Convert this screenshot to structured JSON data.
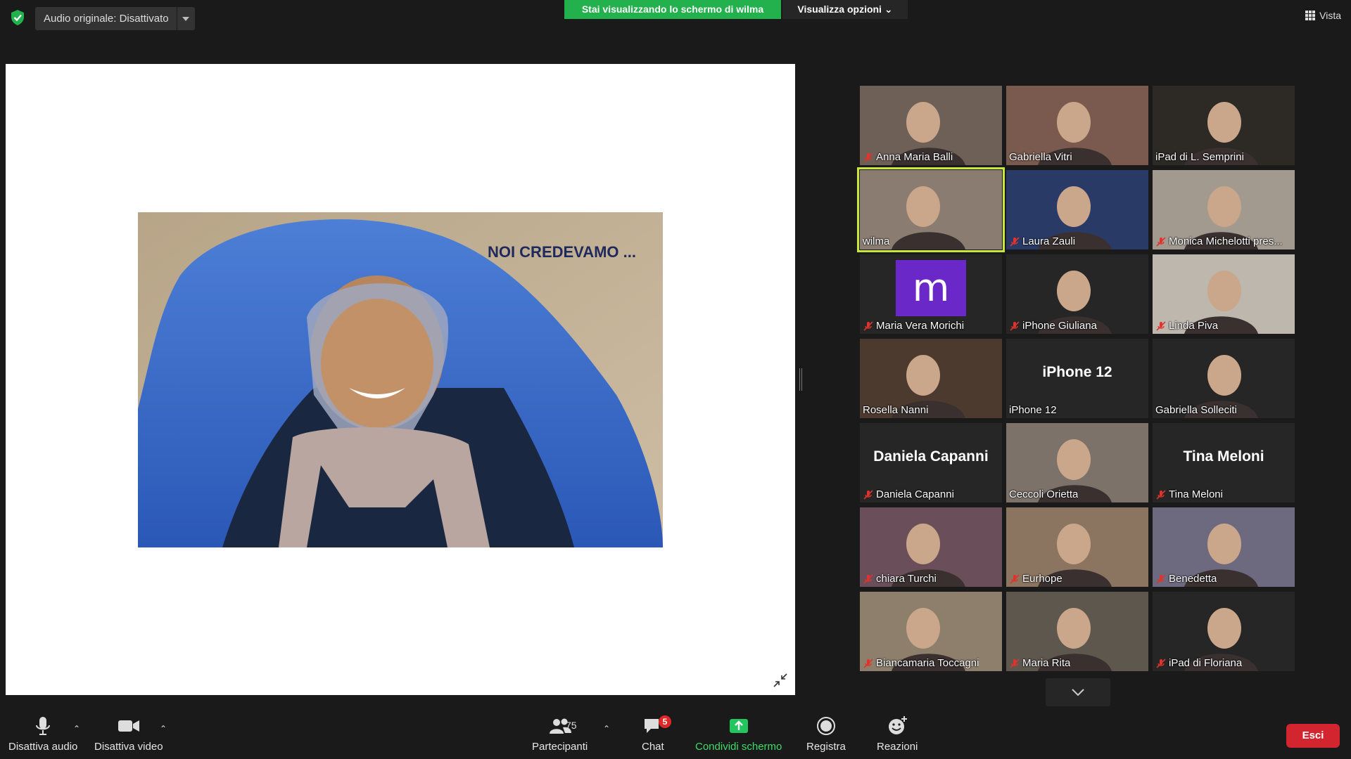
{
  "topbar": {
    "audio_label": "Audio originale: Disattivato",
    "share_banner": "Stai visualizzando lo schermo di wilma",
    "view_options": "Visualizza opzioni",
    "view_label": "Vista"
  },
  "slide": {
    "title": "NOI CREDEVAMO ..."
  },
  "participants": [
    {
      "name": "Anna Maria Balli",
      "muted": true
    },
    {
      "name": "Gabriella Vitri",
      "muted": false
    },
    {
      "name": "iPad di L. Semprini",
      "muted": false
    },
    {
      "name": "wilma",
      "muted": false,
      "active": true
    },
    {
      "name": "Laura Zauli",
      "muted": true
    },
    {
      "name": "Monica Michelotti pres...",
      "muted": true
    },
    {
      "name": "Maria Vera Morichi",
      "muted": true,
      "avatar_letter": "m"
    },
    {
      "name": "iPhone Giuliana",
      "muted": true
    },
    {
      "name": "Linda Piva",
      "muted": true
    },
    {
      "name": "Rosella Nanni",
      "muted": false
    },
    {
      "name": "iPhone 12",
      "muted": false,
      "center_label": "iPhone 12"
    },
    {
      "name": "Gabriella Solleciti",
      "muted": false
    },
    {
      "name": "Daniela Capanni",
      "muted": true,
      "center_label": "Daniela Capanni"
    },
    {
      "name": "Ceccoli Orietta",
      "muted": false
    },
    {
      "name": "Tina Meloni",
      "muted": true,
      "center_label": "Tina Meloni"
    },
    {
      "name": "chiara Turchi",
      "muted": true
    },
    {
      "name": "Eurhope",
      "muted": true
    },
    {
      "name": "Benedetta",
      "muted": true
    },
    {
      "name": "Biancamaria Toccagni",
      "muted": true
    },
    {
      "name": "Maria Rita",
      "muted": true
    },
    {
      "name": "iPad di Floriana",
      "muted": true
    }
  ],
  "toolbar": {
    "audio": "Disattiva audio",
    "video": "Disattiva video",
    "participants": "Partecipanti",
    "participants_count": "75",
    "chat": "Chat",
    "chat_badge": "5",
    "share": "Condividi schermo",
    "record": "Registra",
    "reactions": "Reazioni",
    "leave": "Esci"
  },
  "colors": {
    "share_green": "#22b14c",
    "leave_red": "#d2252f",
    "active_speaker": "#c8e63b",
    "avatar_purple": "#6a28c9"
  }
}
